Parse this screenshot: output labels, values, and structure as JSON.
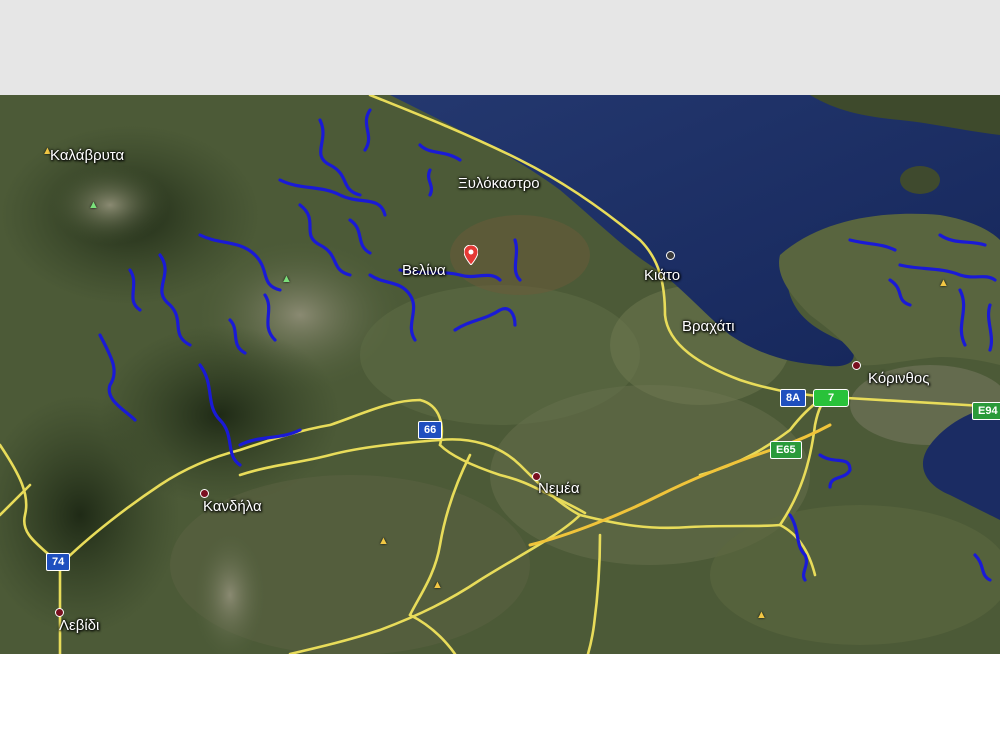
{
  "map": {
    "places": [
      {
        "id": "kalavryta",
        "name": "Καλάβρυτα"
      },
      {
        "id": "xylokastro",
        "name": "Ξυλόκαστρο"
      },
      {
        "id": "velina",
        "name": "Βελίνα"
      },
      {
        "id": "kiato",
        "name": "Κιάτο"
      },
      {
        "id": "vrachati",
        "name": "Βραχάτι"
      },
      {
        "id": "korinthos",
        "name": "Κόρινθος"
      },
      {
        "id": "nemea",
        "name": "Νεμέα"
      },
      {
        "id": "kandila",
        "name": "Κανδήλα"
      },
      {
        "id": "levidi",
        "name": "Λεβίδι"
      }
    ],
    "road_shields": [
      {
        "id": "r66",
        "label": "66",
        "style": "blue"
      },
      {
        "id": "r74",
        "label": "74",
        "style": "blue"
      },
      {
        "id": "r8a",
        "label": "8A",
        "style": "blue"
      },
      {
        "id": "r7",
        "label": "7",
        "style": "green-big"
      },
      {
        "id": "e65",
        "label": "E65",
        "style": "green"
      },
      {
        "id": "e94",
        "label": "E94",
        "style": "green"
      }
    ],
    "colors": {
      "land": "#4a5a35",
      "sea": "#1c2f66",
      "road": "#e8dc5a",
      "river_overlay": "#1a1ad6",
      "town_marker": "#7a1020",
      "pin": "#e53935"
    }
  }
}
